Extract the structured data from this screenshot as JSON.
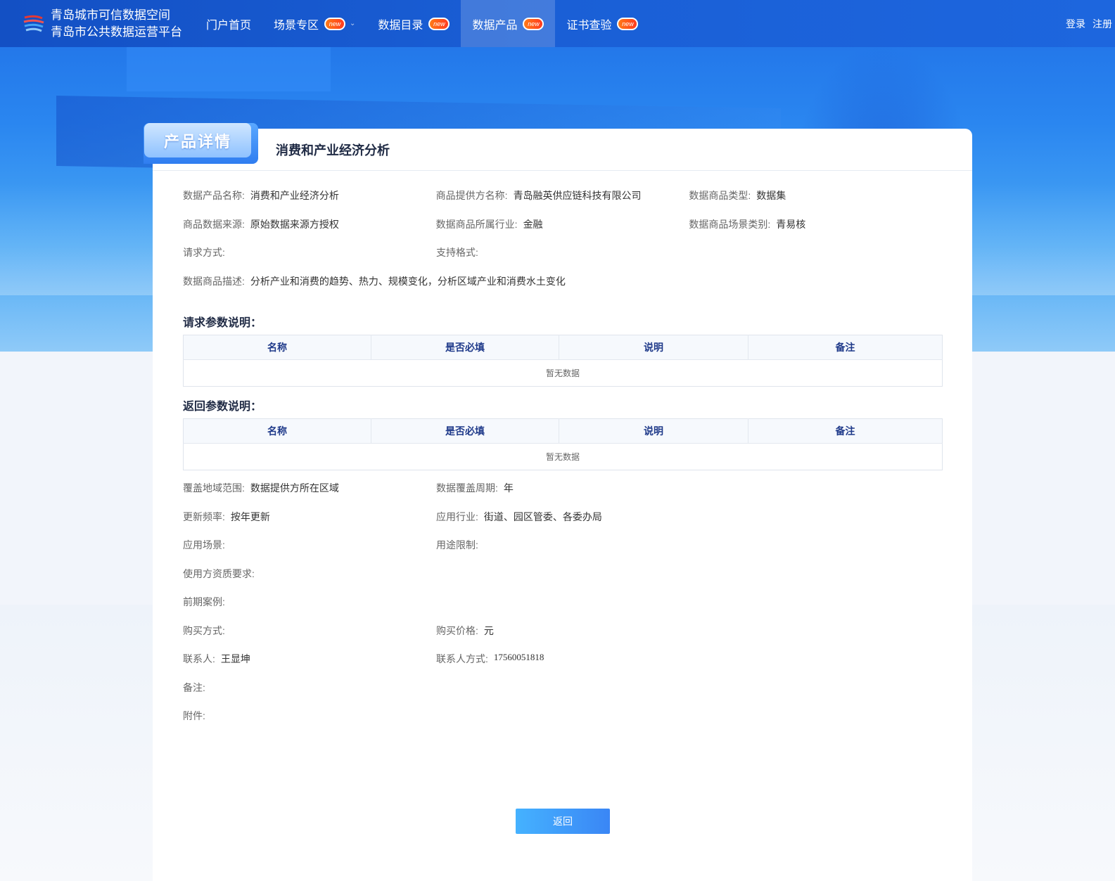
{
  "brand": {
    "line1": "青岛城市可信数据空间",
    "line2": "青岛市公共数据运营平台"
  },
  "nav": {
    "home": "门户首页",
    "scenes": "场景专区",
    "catalog": "数据目录",
    "products": "数据产品",
    "certs": "证书查验",
    "badge": "new"
  },
  "auth": {
    "login": "登录",
    "register": "注册"
  },
  "detail": {
    "tag": "产品详情",
    "title": "消费和产业经济分析"
  },
  "fields": {
    "product_name": {
      "label": "数据产品名称:",
      "value": "消费和产业经济分析"
    },
    "provider": {
      "label": "商品提供方名称:",
      "value": "青岛融英供应链科技有限公司"
    },
    "type": {
      "label": "数据商品类型:",
      "value": "数据集"
    },
    "source": {
      "label": "商品数据来源:",
      "value": "原始数据来源方授权"
    },
    "industry": {
      "label": "数据商品所属行业:",
      "value": "金融"
    },
    "scene_cat": {
      "label": "数据商品场景类别:",
      "value": "青易核"
    },
    "req_method": {
      "label": "请求方式:",
      "value": ""
    },
    "format": {
      "label": "支持格式:",
      "value": ""
    },
    "desc": {
      "label": "数据商品描述:",
      "value": "分析产业和消费的趋势、热力、规模变化，分析区域产业和消费水土变化"
    },
    "coverage": {
      "label": "覆盖地域范围:",
      "value": "数据提供方所在区域"
    },
    "period": {
      "label": "数据覆盖周期:",
      "value": "年"
    },
    "frequency": {
      "label": "更新频率:",
      "value": "按年更新"
    },
    "app_industry": {
      "label": "应用行业:",
      "value": "街道、园区管委、各委办局"
    },
    "app_scene": {
      "label": "应用场景:",
      "value": ""
    },
    "usage_limit": {
      "label": "用途限制:",
      "value": ""
    },
    "qualification": {
      "label": "使用方资质要求:",
      "value": ""
    },
    "cases": {
      "label": "前期案例:",
      "value": ""
    },
    "buy_method": {
      "label": "购买方式:",
      "value": ""
    },
    "price": {
      "label": "购买价格:",
      "value": "元"
    },
    "contact": {
      "label": "联系人:",
      "value": "王显坤"
    },
    "contact_way": {
      "label": "联系人方式:",
      "value": "17560051818"
    },
    "remark": {
      "label": "备注:",
      "value": ""
    },
    "attachment": {
      "label": "附件:",
      "value": ""
    }
  },
  "request_params": {
    "title": "请求参数说明：",
    "columns": [
      "名称",
      "是否必填",
      "说明",
      "备注"
    ],
    "empty": "暂无数据"
  },
  "response_params": {
    "title": "返回参数说明：",
    "columns": [
      "名称",
      "是否必填",
      "说明",
      "备注"
    ],
    "empty": "暂无数据"
  },
  "back_button": "返回",
  "colors": {
    "nav_bg": "#1a5fd6",
    "accent": "#3a86f5",
    "badge": "#ff5a1f",
    "table_header_text": "#1f3a8a"
  }
}
